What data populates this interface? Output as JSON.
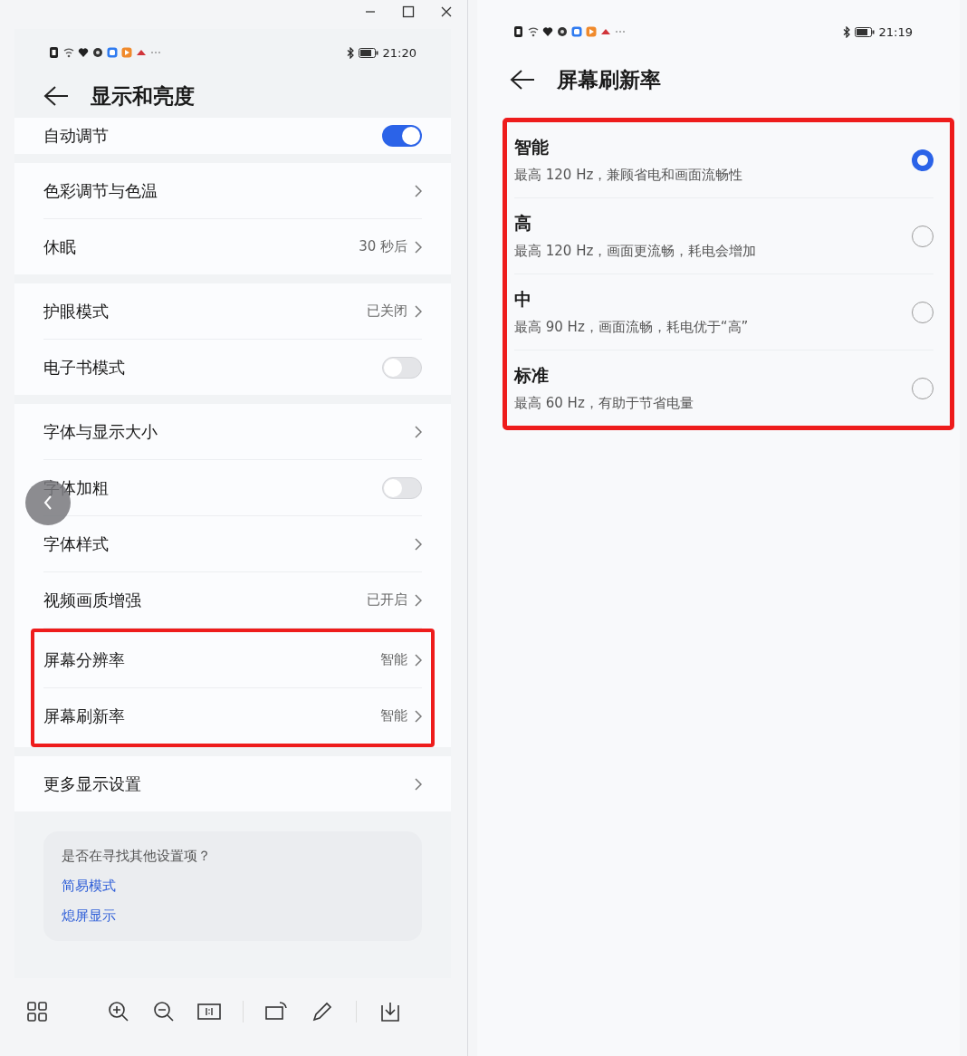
{
  "left": {
    "status_bar": {
      "time": "21:20"
    },
    "title": "显示和亮度",
    "groups": [
      {
        "items": [
          {
            "kind": "toggle",
            "label": "自动调节",
            "on": true,
            "highlighted": false
          }
        ]
      },
      {
        "items": [
          {
            "kind": "link",
            "label": "色彩调节与色温",
            "highlighted": false
          },
          {
            "kind": "link",
            "label": "休眠",
            "value": "30 秒后",
            "highlighted": false
          }
        ]
      },
      {
        "items": [
          {
            "kind": "link",
            "label": "护眼模式",
            "value": "已关闭",
            "highlighted": false
          },
          {
            "kind": "toggle",
            "label": "电子书模式",
            "on": false,
            "highlighted": false
          }
        ]
      },
      {
        "items": [
          {
            "kind": "link",
            "label": "字体与显示大小",
            "highlighted": false
          },
          {
            "kind": "toggle",
            "label": "字体加粗",
            "on": false,
            "highlighted": false
          },
          {
            "kind": "link",
            "label": "字体样式",
            "highlighted": false
          },
          {
            "kind": "link",
            "label": "视频画质增强",
            "value": "已开启",
            "highlighted": false
          },
          {
            "kind": "link",
            "label": "屏幕分辨率",
            "value": "智能",
            "highlighted": true
          },
          {
            "kind": "link",
            "label": "屏幕刷新率",
            "value": "智能",
            "highlighted": true
          }
        ]
      },
      {
        "items": [
          {
            "kind": "link",
            "label": "更多显示设置",
            "highlighted": false
          }
        ]
      }
    ],
    "suggestion": {
      "question": "是否在寻找其他设置项？",
      "links": [
        "简易模式",
        "熄屏显示"
      ]
    }
  },
  "right": {
    "status_bar": {
      "time": "21:19"
    },
    "title": "屏幕刷新率",
    "highlighted": true,
    "options": [
      {
        "label": "智能",
        "description": "最高 120 Hz，兼顾省电和画面流畅性",
        "selected": true
      },
      {
        "label": "高",
        "description": "最高 120 Hz，画面更流畅，耗电会增加",
        "selected": false
      },
      {
        "label": "中",
        "description": "最高 90 Hz，画面流畅，耗电优于“高”",
        "selected": false
      },
      {
        "label": "标准",
        "description": "最高 60 Hz，有助于节省电量",
        "selected": false
      }
    ]
  }
}
